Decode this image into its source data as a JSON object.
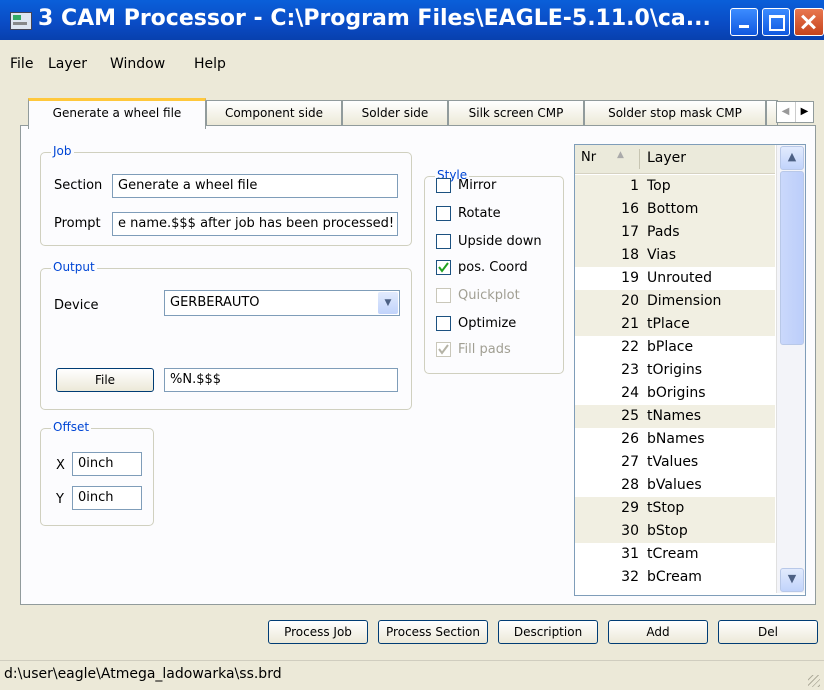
{
  "window": {
    "title": "3 CAM Processor - C:\\Program Files\\EAGLE-5.11.0\\ca..."
  },
  "menu": [
    "File",
    "Layer",
    "Window",
    "Help"
  ],
  "tabs": [
    "Generate a wheel file",
    "Component side",
    "Solder side",
    "Silk screen CMP",
    "Solder stop mask CMP"
  ],
  "job": {
    "legend": "Job",
    "section_label": "Section",
    "section_value": "Generate a wheel file",
    "prompt_label": "Prompt",
    "prompt_value": "e name.$$$ after job has been processed!"
  },
  "output": {
    "legend": "Output",
    "device_label": "Device",
    "device_value": "GERBERAUTO",
    "file_button": "File",
    "file_value": "%N.$$$"
  },
  "offset": {
    "legend": "Offset",
    "x_label": "X",
    "x_value": "0inch",
    "y_label": "Y",
    "y_value": "0inch"
  },
  "style": {
    "legend": "Style",
    "options": [
      {
        "label": "Mirror",
        "checked": false,
        "enabled": true
      },
      {
        "label": "Rotate",
        "checked": false,
        "enabled": true
      },
      {
        "label": "Upside down",
        "checked": false,
        "enabled": true
      },
      {
        "label": "pos. Coord",
        "checked": true,
        "enabled": true
      },
      {
        "label": "Quickplot",
        "checked": false,
        "enabled": false
      },
      {
        "label": "Optimize",
        "checked": false,
        "enabled": true
      },
      {
        "label": "Fill pads",
        "checked": true,
        "enabled": false
      }
    ]
  },
  "layers": {
    "col_nr": "Nr",
    "col_layer": "Layer",
    "rows": [
      {
        "nr": "1",
        "name": "Top",
        "selected": true
      },
      {
        "nr": "16",
        "name": "Bottom",
        "selected": true
      },
      {
        "nr": "17",
        "name": "Pads",
        "selected": true
      },
      {
        "nr": "18",
        "name": "Vias",
        "selected": true
      },
      {
        "nr": "19",
        "name": "Unrouted",
        "selected": false
      },
      {
        "nr": "20",
        "name": "Dimension",
        "selected": true
      },
      {
        "nr": "21",
        "name": "tPlace",
        "selected": true
      },
      {
        "nr": "22",
        "name": "bPlace",
        "selected": false
      },
      {
        "nr": "23",
        "name": "tOrigins",
        "selected": false
      },
      {
        "nr": "24",
        "name": "bOrigins",
        "selected": false
      },
      {
        "nr": "25",
        "name": "tNames",
        "selected": true
      },
      {
        "nr": "26",
        "name": "bNames",
        "selected": false
      },
      {
        "nr": "27",
        "name": "tValues",
        "selected": false
      },
      {
        "nr": "28",
        "name": "bValues",
        "selected": false
      },
      {
        "nr": "29",
        "name": "tStop",
        "selected": true
      },
      {
        "nr": "30",
        "name": "bStop",
        "selected": true
      },
      {
        "nr": "31",
        "name": "tCream",
        "selected": false
      },
      {
        "nr": "32",
        "name": "bCream",
        "selected": false
      }
    ]
  },
  "buttons": {
    "process_job": "Process Job",
    "process_section": "Process Section",
    "description": "Description",
    "add": "Add",
    "del": "Del"
  },
  "status": {
    "path": "d:\\user\\eagle\\Atmega_ladowarka\\ss.brd"
  },
  "colors": {
    "titlebar": "#0a50cc",
    "legend": "#0046d5",
    "selected_row": "#f1efe2",
    "check": "#21a121"
  }
}
